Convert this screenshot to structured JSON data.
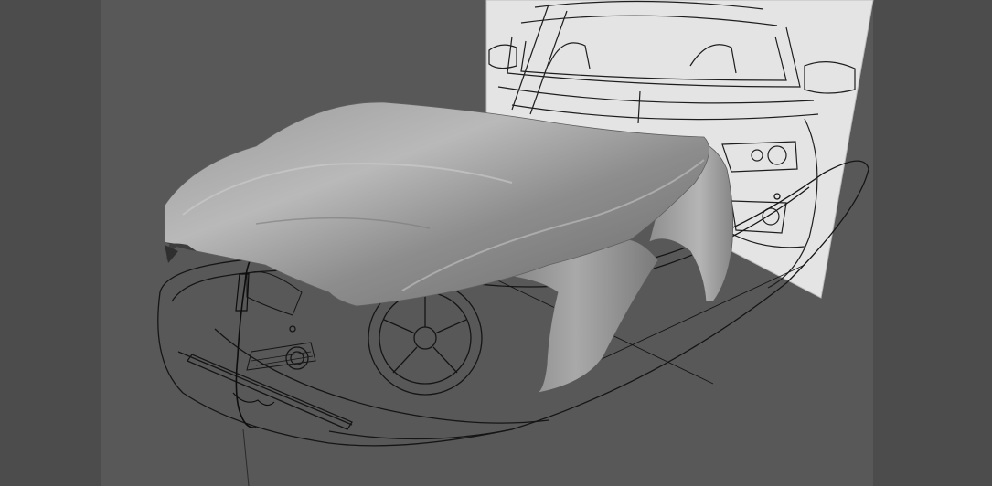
{
  "viewport": {
    "view": "3d-perspective",
    "colors": {
      "background": "#585858",
      "side_bands": "#4c4c4c",
      "blueprint_plane": "#e6e6e6",
      "blueprint_lines": "#1e1e1e",
      "mesh_light": "#c8c8c8",
      "mesh_dark": "#6a6a6a"
    },
    "objects": [
      {
        "name": "front-view-reference-image",
        "icon": "image-plane"
      },
      {
        "name": "top-view-reference-image",
        "icon": "image-plane"
      },
      {
        "name": "hood-and-fender-mesh",
        "icon": "mesh"
      },
      {
        "name": "profile-curve",
        "icon": "curve"
      }
    ]
  }
}
